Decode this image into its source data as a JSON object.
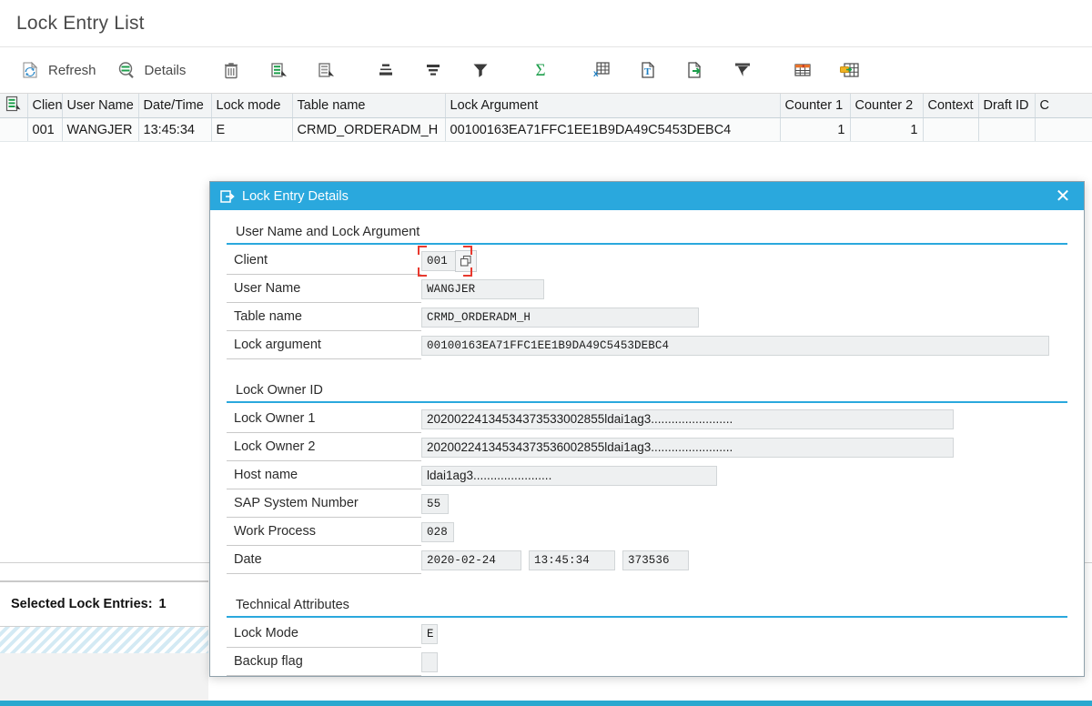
{
  "app": {
    "title": "Lock Entry List"
  },
  "toolbar": {
    "buttons": [
      {
        "label": "Refresh",
        "icon": "refresh-icon",
        "type": "text"
      },
      {
        "label": "Details",
        "icon": "details-icon",
        "type": "text"
      },
      {
        "label": "",
        "icon": "delete-trash-icon",
        "type": "icon"
      },
      {
        "label": "",
        "icon": "sort-ascending-icon",
        "type": "icon"
      },
      {
        "label": "",
        "icon": "sort-descending-icon",
        "type": "icon"
      },
      {
        "label": "",
        "icon": "set-filter-icon",
        "type": "icon"
      },
      {
        "label": "",
        "icon": "subtotals-icon",
        "type": "icon"
      },
      {
        "label": "",
        "icon": "filter-funnel-icon",
        "type": "icon"
      },
      {
        "label": "",
        "icon": "sum-sigma-icon",
        "type": "icon"
      },
      {
        "label": "",
        "icon": "spreadsheet-export-icon",
        "type": "icon"
      },
      {
        "label": "",
        "icon": "word-processing-icon",
        "type": "icon"
      },
      {
        "label": "",
        "icon": "local-file-export-icon",
        "type": "icon"
      },
      {
        "label": "",
        "icon": "print-preview-icon",
        "type": "icon"
      },
      {
        "label": "",
        "icon": "change-layout-icon",
        "type": "icon"
      },
      {
        "label": "",
        "icon": "select-layout-icon",
        "type": "icon"
      }
    ]
  },
  "list": {
    "select_column_icon": "select-all-rows-icon",
    "columns": [
      "Client",
      "User Name",
      "Date/Time",
      "Lock mode",
      "Table name",
      "Lock Argument",
      "Counter 1",
      "Counter 2",
      "Context",
      "Draft ID",
      "C"
    ],
    "rows": [
      {
        "client": "001",
        "user_name": "WANGJER",
        "date_time": "13:45:34",
        "lock_mode": "E",
        "table_name": "CRMD_ORDERADM_H",
        "lock_argument": "00100163EA71FFC1EE1B9DA49C5453DEBC4",
        "counter_1": "1",
        "counter_2": "1",
        "context": "",
        "draft_id": "",
        "c": ""
      }
    ]
  },
  "footer": {
    "selected_label": "Selected Lock Entries:",
    "selected_count": "1"
  },
  "dialog": {
    "title": "Lock Entry Details",
    "title_icon": "lock-entry-details-icon",
    "close_icon": "close-icon",
    "sections": {
      "user_lock": {
        "title": "User Name and Lock Argument",
        "client_label": "Client",
        "client_value": "001",
        "client_value_help_icon": "value-help-icon",
        "user_name_label": "User Name",
        "user_name_value": "WANGJER",
        "table_name_label": "Table name",
        "table_name_value": "CRMD_ORDERADM_H",
        "lock_argument_label": "Lock argument",
        "lock_argument_value": "00100163EA71FFC1EE1B9DA49C5453DEBC4"
      },
      "lock_owner": {
        "title": "Lock Owner ID",
        "owner1_label": "Lock Owner 1",
        "owner1_value": "20200224134534373533002855ldai1ag3........................",
        "owner2_label": "Lock Owner 2",
        "owner2_value": "20200224134534373536002855ldai1ag3........................",
        "host_label": "Host name",
        "host_value": "ldai1ag3.......................",
        "sap_system_number_label": "SAP System Number",
        "sap_system_number_value": "55",
        "work_process_label": "Work Process",
        "work_process_value": "028",
        "date_label": "Date",
        "date_value": "2020-02-24",
        "time_value": "13:45:34",
        "micro_value": "373536"
      },
      "technical": {
        "title": "Technical Attributes",
        "lock_mode_label": "Lock Mode",
        "lock_mode_value": "E",
        "backup_flag_label": "Backup flag",
        "backup_flag_value": ""
      }
    }
  },
  "colors": {
    "accent": "#2aa8dd",
    "highlight_row": "#d7ecf5",
    "focus_marker": "#e8392e",
    "header_bg": "#f2f4f5"
  }
}
